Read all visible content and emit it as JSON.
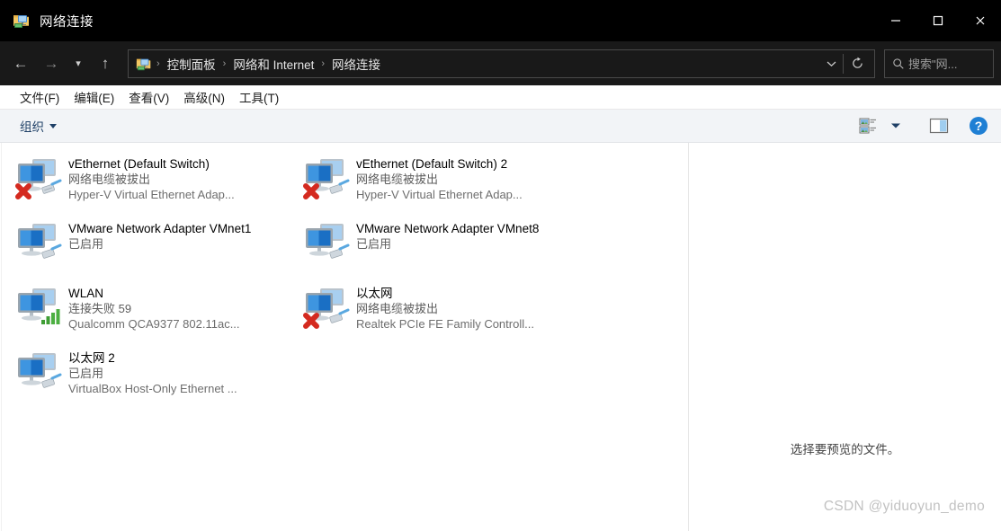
{
  "window": {
    "title": "网络连接",
    "title_icon": "network-folder-icon",
    "controls": {
      "minimize": "minimize-icon",
      "maximize": "maximize-icon",
      "close": "close-icon"
    }
  },
  "addressbar": {
    "back": "back-arrow-icon",
    "forward": "forward-arrow-icon",
    "recent": "chevron-down-icon",
    "up": "up-arrow-icon",
    "path_icon": "network-folder-icon",
    "crumbs": [
      "控制面板",
      "网络和 Internet",
      "网络连接"
    ],
    "separator": "›",
    "dropdown": "chevron-down-icon",
    "refresh": "refresh-icon",
    "search": {
      "icon": "search-icon",
      "placeholder": "搜索\"网...",
      "value": ""
    }
  },
  "menubar": {
    "items": [
      {
        "label": "文件(F)"
      },
      {
        "label": "编辑(E)"
      },
      {
        "label": "查看(V)"
      },
      {
        "label": "高级(N)"
      },
      {
        "label": "工具(T)"
      }
    ]
  },
  "toolbar": {
    "organize_label": "组织",
    "view_options_icon": "view-options-icon",
    "view_dropdown_icon": "chevron-down-icon",
    "preview_pane_icon": "preview-pane-icon",
    "help_icon": "help-icon",
    "help_label": "?"
  },
  "connections": [
    {
      "name": "vEthernet (Default Switch)",
      "status": "网络电缆被拔出",
      "device": "Hyper-V Virtual Ethernet Adap...",
      "icon": "network-adapter-icon",
      "overlay": "red-x-icon",
      "media": "rj45-cable-icon"
    },
    {
      "name": "vEthernet (Default Switch) 2",
      "status": "网络电缆被拔出",
      "device": "Hyper-V Virtual Ethernet Adap...",
      "icon": "network-adapter-icon",
      "overlay": "red-x-icon",
      "media": "rj45-cable-icon"
    },
    {
      "name": "VMware Network Adapter VMnet1",
      "status": "已启用",
      "device": "",
      "icon": "network-adapter-icon",
      "overlay": "",
      "media": "rj45-cable-icon"
    },
    {
      "name": "VMware Network Adapter VMnet8",
      "status": "已启用",
      "device": "",
      "icon": "network-adapter-icon",
      "overlay": "",
      "media": "rj45-cable-icon"
    },
    {
      "name": "WLAN",
      "status": "连接失败 59",
      "device": "Qualcomm QCA9377 802.11ac...",
      "icon": "network-adapter-icon",
      "overlay": "",
      "media": "wifi-signal-icon"
    },
    {
      "name": "以太网",
      "status": "网络电缆被拔出",
      "device": "Realtek PCIe FE Family Controll...",
      "icon": "network-adapter-icon",
      "overlay": "red-x-icon",
      "media": "rj45-cable-icon"
    },
    {
      "name": "以太网 2",
      "status": "已启用",
      "device": "VirtualBox Host-Only Ethernet ...",
      "icon": "network-adapter-icon",
      "overlay": "",
      "media": "rj45-cable-icon"
    }
  ],
  "preview": {
    "message": "选择要预览的文件。",
    "watermark": "CSDN @yiduoyun_demo"
  },
  "colors": {
    "titlebar_bg": "#000000",
    "addressbar_bg": "#191919",
    "toolbar_bg": "#f2f4f7",
    "accent_blue": "#1e3f66",
    "help_blue": "#1f7fd4",
    "error_red": "#d42a1f",
    "signal_green": "#3f9e35",
    "body_bg": "#ffffff"
  }
}
